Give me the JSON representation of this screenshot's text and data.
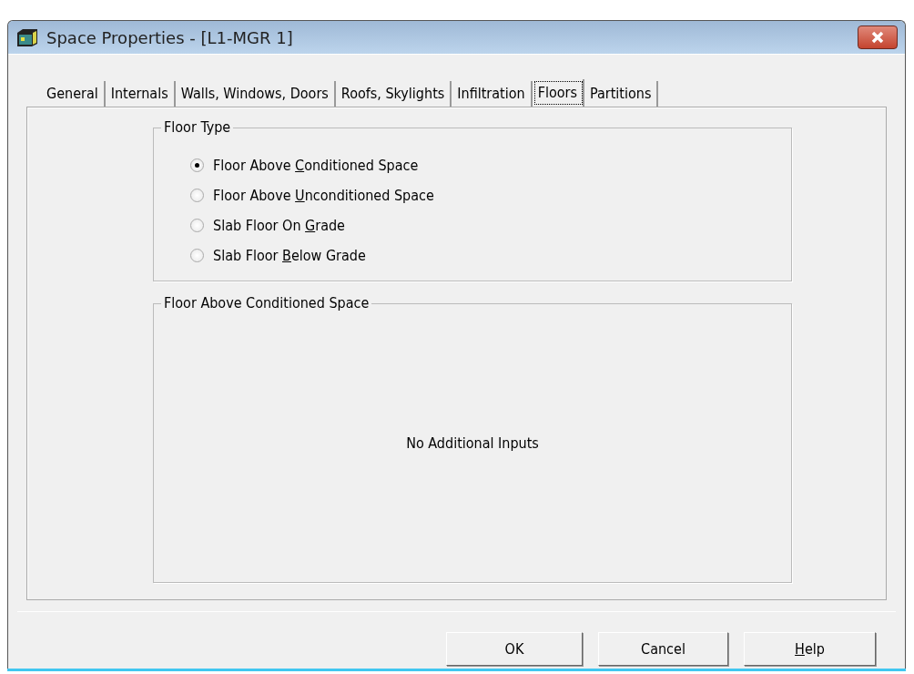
{
  "window": {
    "title": "Space Properties - [L1-MGR 1]"
  },
  "tabs": [
    {
      "label": "General",
      "selected": false
    },
    {
      "label": "Internals",
      "selected": false
    },
    {
      "label": "Walls, Windows, Doors",
      "selected": false
    },
    {
      "label": "Roofs, Skylights",
      "selected": false
    },
    {
      "label": "Infiltration",
      "selected": false
    },
    {
      "label": "Floors",
      "selected": true
    },
    {
      "label": "Partitions",
      "selected": false
    }
  ],
  "floor_type": {
    "title": "Floor Type",
    "options": [
      {
        "pre": "Floor Above ",
        "key": "C",
        "post": "onditioned Space",
        "selected": true
      },
      {
        "pre": "Floor Above ",
        "key": "U",
        "post": "nconditioned Space",
        "selected": false
      },
      {
        "pre": "Slab Floor On ",
        "key": "G",
        "post": "rade",
        "selected": false
      },
      {
        "pre": "Slab Floor ",
        "key": "B",
        "post": "elow Grade",
        "selected": false
      }
    ]
  },
  "details": {
    "title": "Floor Above Conditioned Space",
    "message": "No Additional Inputs"
  },
  "buttons": [
    {
      "post": "OK"
    },
    {
      "post": "Cancel"
    },
    {
      "key": "H",
      "post": "elp"
    }
  ]
}
